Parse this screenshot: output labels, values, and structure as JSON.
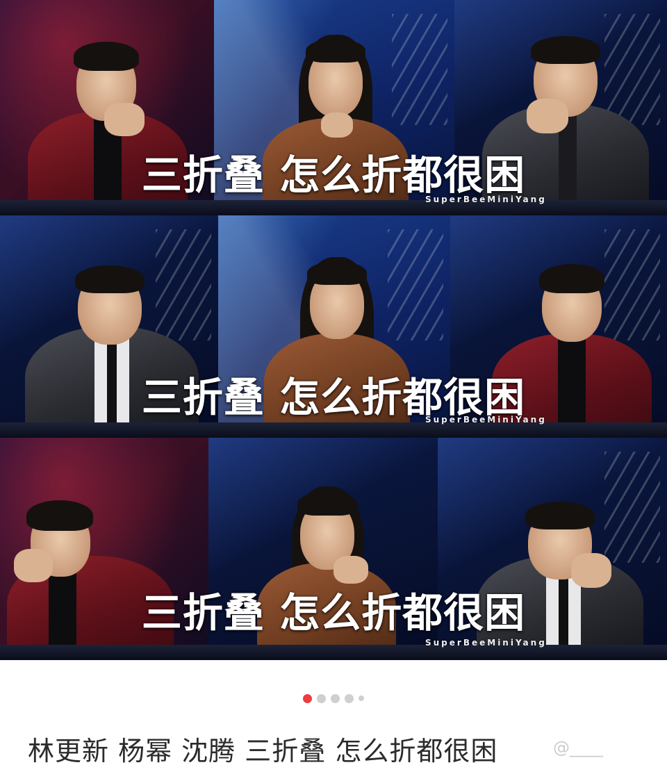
{
  "gallery": {
    "rows": [
      {
        "caption": "三折叠 怎么折都很困",
        "watermark": "SuperBeeMiniYang"
      },
      {
        "caption": "三折叠 怎么折都很困",
        "watermark": "SuperBeeMiniYang"
      },
      {
        "caption": "三折叠 怎么折都很困",
        "watermark": "SuperBeeMiniYang"
      }
    ]
  },
  "pagination": {
    "total": 5,
    "active_index": 0,
    "active_color": "#ef3b42",
    "inactive_color": "#cfcfcf"
  },
  "post": {
    "text": "林更新 杨幂 沈腾 三折叠 怎么折都很困",
    "user_tag": "@____"
  }
}
